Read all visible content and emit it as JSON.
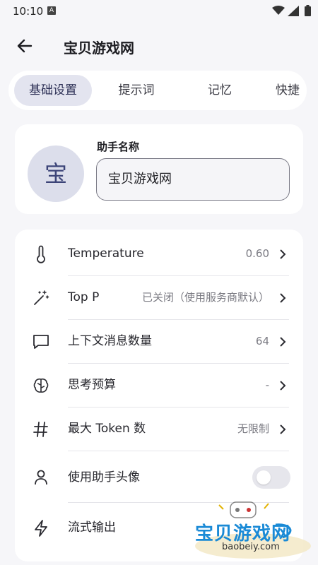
{
  "status_bar": {
    "time": "10:10",
    "notif_letter": "A"
  },
  "header": {
    "title": "宝贝游戏网",
    "back_icon": "arrow-left-icon"
  },
  "tabs": [
    {
      "label": "基础设置",
      "active": true
    },
    {
      "label": "提示词",
      "active": false
    },
    {
      "label": "记忆",
      "active": false
    },
    {
      "label": "快捷",
      "active": false
    }
  ],
  "assistant": {
    "avatar_text": "宝",
    "name_label": "助手名称",
    "name_value": "宝贝游戏网"
  },
  "settings": [
    {
      "icon": "thermometer-icon",
      "label": "Temperature",
      "value": "0.60"
    },
    {
      "icon": "magic-wand-icon",
      "label": "Top P",
      "value": "已关闭（使用服务商默认）"
    },
    {
      "icon": "message-square-icon",
      "label": "上下文消息数量",
      "value": "64"
    },
    {
      "icon": "brain-icon",
      "label": "思考预算",
      "value": "-"
    },
    {
      "icon": "hash-icon",
      "label": "最大 Token 数",
      "value": "无限制"
    },
    {
      "icon": "user-icon",
      "label": "使用助手头像",
      "toggle": false
    },
    {
      "icon": "lightning-icon",
      "label": "流式输出"
    }
  ],
  "watermark": {
    "text": "宝贝游戏网",
    "url": "baobeiy.com"
  },
  "colors": {
    "accent": "#2c2f55",
    "tab_active_bg": "#e3e4ef",
    "avatar_bg": "#dcdeeb",
    "page_bg": "#f6f6f9"
  }
}
